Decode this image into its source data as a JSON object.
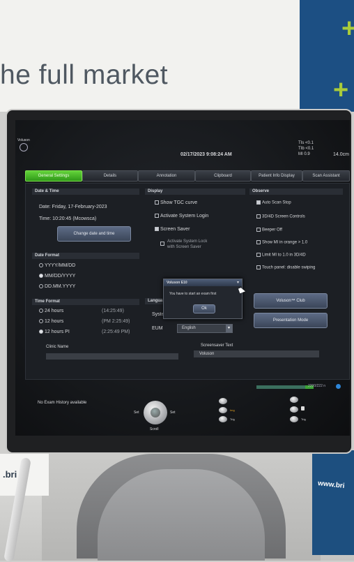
{
  "banner": {
    "slogan": "he full market",
    "right_sign": "www.bri",
    "left_sign": ".bri"
  },
  "screen": {
    "logo": "Voluson",
    "datetime": "02/17/2023   9:08:24 AM",
    "indices": {
      "tis": "TIs <0.1",
      "tib": "TIb <0.1",
      "mi": "MI  0.9",
      "depth": "14.0cm"
    },
    "tabs": [
      "General Settings",
      "Details",
      "Annotation",
      "Clipboard",
      "Patient Info Display",
      "Scan Assistant"
    ],
    "date_time": {
      "title": "Date & Time",
      "date": "Date:  Friday, 17-February-2023",
      "time": "Time:  10:20:45 (Mcowsca)",
      "button": "Change date and time"
    },
    "date_format": {
      "title": "Date Format",
      "options": [
        "YYYY/MM/DD",
        "MM/DD/YYYY",
        "DD.MM.YYYY"
      ],
      "selected": 1
    },
    "time_format": {
      "title": "Time Format",
      "options": [
        {
          "label": "24 hours",
          "example": "(14:25:49)",
          "on": false
        },
        {
          "label": "12 hours",
          "example": "(PM 2:25:49)",
          "on": false
        },
        {
          "label": "12 hours PI",
          "example": "(2:25:49 PM)",
          "on": true
        }
      ]
    },
    "display": {
      "title": "Display",
      "items": [
        {
          "label": "Show TGC curve",
          "on": false
        },
        {
          "label": "Activate System Login",
          "on": false
        },
        {
          "label": "Screen Saver",
          "on": true
        }
      ],
      "sub_item": "Activate System Lock\nwith Screen Saver"
    },
    "languages": {
      "title": "Langua",
      "row1_label": "Syste",
      "row2_label": "EUM",
      "row2_value": "English"
    },
    "observe": {
      "title": "Observe",
      "items": [
        {
          "label": "Auto Scan Stop",
          "on": true
        },
        {
          "label": "3D/4D Screen Controls",
          "on": false
        },
        {
          "label": "Beeper Off",
          "on": false
        },
        {
          "label": "Show MI in orange > 1.0",
          "on": false
        },
        {
          "label": "Limit MI to 1.0 in 3D/4D",
          "on": false
        },
        {
          "label": "Touch panel: disable swiping",
          "on": false
        }
      ],
      "buttons": [
        "Voluson™ Club",
        "Presentation Mode"
      ]
    },
    "dialog": {
      "title": "Voluson E10",
      "message": "You have to start an exam first",
      "ok": "Ok"
    },
    "clinic_name": "Clinic Name",
    "screensaver": {
      "label": "Screensaver Text",
      "value": "Voluson"
    },
    "disk": "2200/222 n",
    "no_history": "No Exam History available",
    "controls": {
      "left": "Set",
      "right": "Set",
      "bottom": "Scroll",
      "mid1": "Img",
      "mid2": "Trig",
      "right1": "",
      "right2": "Trig"
    }
  }
}
